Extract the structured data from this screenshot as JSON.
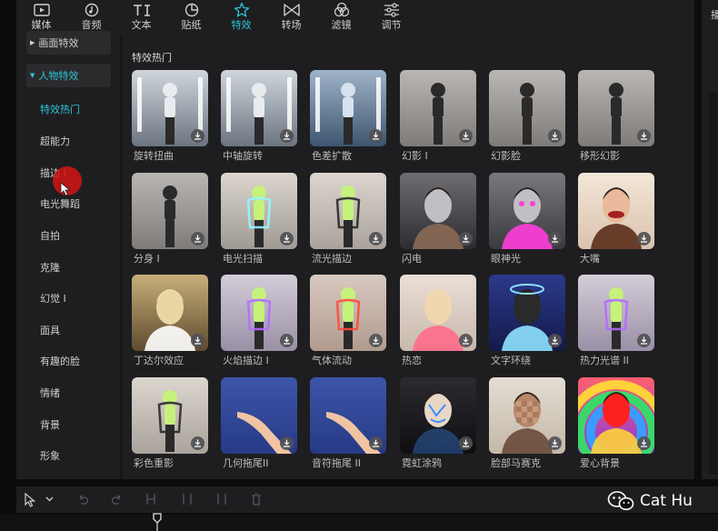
{
  "toolbar": {
    "tools": [
      {
        "label": "媒体",
        "icon": "media-icon"
      },
      {
        "label": "音频",
        "icon": "audio-icon"
      },
      {
        "label": "文本",
        "icon": "text-icon"
      },
      {
        "label": "贴纸",
        "icon": "sticker-icon"
      },
      {
        "label": "特效",
        "icon": "effects-icon",
        "active": true
      },
      {
        "label": "转场",
        "icon": "transition-icon"
      },
      {
        "label": "滤镜",
        "icon": "filter-icon"
      },
      {
        "label": "调节",
        "icon": "adjust-icon"
      }
    ],
    "accent_color": "#2cc5d6"
  },
  "right_panel": {
    "title": "播"
  },
  "sidebar": {
    "categories": [
      {
        "label": "画面特效"
      },
      {
        "label": "人物特效",
        "active": true
      }
    ],
    "subitems": [
      {
        "label": "特效热门",
        "active": true
      },
      {
        "label": "超能力"
      },
      {
        "label": "描边 I"
      },
      {
        "label": "电光舞蹈"
      },
      {
        "label": "自拍"
      },
      {
        "label": "克隆"
      },
      {
        "label": "幻觉 I"
      },
      {
        "label": "面具"
      },
      {
        "label": "有趣的脸"
      },
      {
        "label": "情绪"
      },
      {
        "label": "背景"
      },
      {
        "label": "形象"
      }
    ]
  },
  "main": {
    "section_title": "特效热门",
    "effects": [
      {
        "label": "旋转扭曲",
        "theme": "silver"
      },
      {
        "label": "中轴旋转",
        "theme": "silver"
      },
      {
        "label": "色差扩散",
        "theme": "silver-blue"
      },
      {
        "label": "幻影 I",
        "theme": "grey"
      },
      {
        "label": "幻影脸",
        "theme": "grey"
      },
      {
        "label": "移形幻影",
        "theme": "grey"
      },
      {
        "label": "分身 I",
        "theme": "grey"
      },
      {
        "label": "电光扫描",
        "theme": "lime-glow"
      },
      {
        "label": "流光描边",
        "theme": "lime"
      },
      {
        "label": "闪电",
        "theme": "dark-grey"
      },
      {
        "label": "眼神光",
        "theme": "dark-pink"
      },
      {
        "label": "大嘴",
        "theme": "face"
      },
      {
        "label": "丁达尔效应",
        "theme": "gold"
      },
      {
        "label": "火焰描边 I",
        "theme": "lime-purple"
      },
      {
        "label": "气体流动",
        "theme": "lime-red"
      },
      {
        "label": "热恋",
        "theme": "blonde"
      },
      {
        "label": "文字环绕",
        "theme": "navy"
      },
      {
        "label": "热力光谱 II",
        "theme": "lime-purple"
      },
      {
        "label": "彩色重影",
        "theme": "lime"
      },
      {
        "label": "几何拖尾II",
        "theme": "blue"
      },
      {
        "label": "音符拖尾 II",
        "theme": "blue"
      },
      {
        "label": "霓虹涂鸦",
        "theme": "neon"
      },
      {
        "label": "脸部马赛克",
        "theme": "mosaic"
      },
      {
        "label": "爱心背景",
        "theme": "rainbow"
      }
    ]
  },
  "watermark": {
    "text": "Cat Hu"
  }
}
